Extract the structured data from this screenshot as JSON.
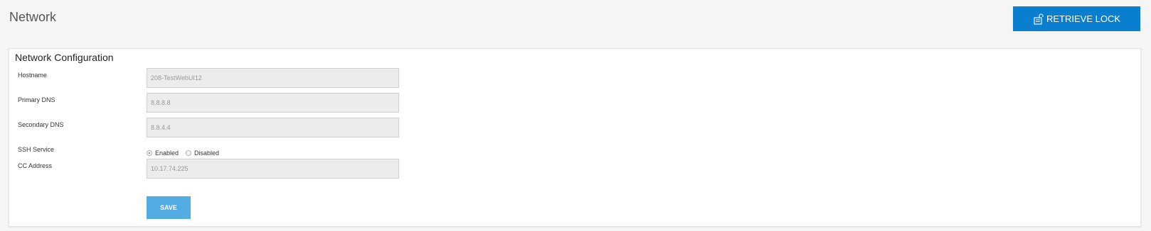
{
  "header": {
    "title": "Network",
    "retrieve_lock_label": "RETRIEVE LOCK",
    "accent_color": "#0a7fcf"
  },
  "panel": {
    "title": "Network Configuration",
    "fields": {
      "hostname": {
        "label": "Hostname",
        "value": "208-TestWebUI12"
      },
      "primary_dns": {
        "label": "Primary DNS",
        "value": "8.8.8.8"
      },
      "secondary_dns": {
        "label": "Secondary DNS",
        "value": "8.8.4.4"
      },
      "ssh_service": {
        "label": "SSH Service",
        "options": [
          "Enabled",
          "Disabled"
        ],
        "selected": "Enabled"
      },
      "cc_address": {
        "label": "CC Address",
        "value": "10.17.74.225"
      }
    },
    "save_label": "SAVE"
  }
}
